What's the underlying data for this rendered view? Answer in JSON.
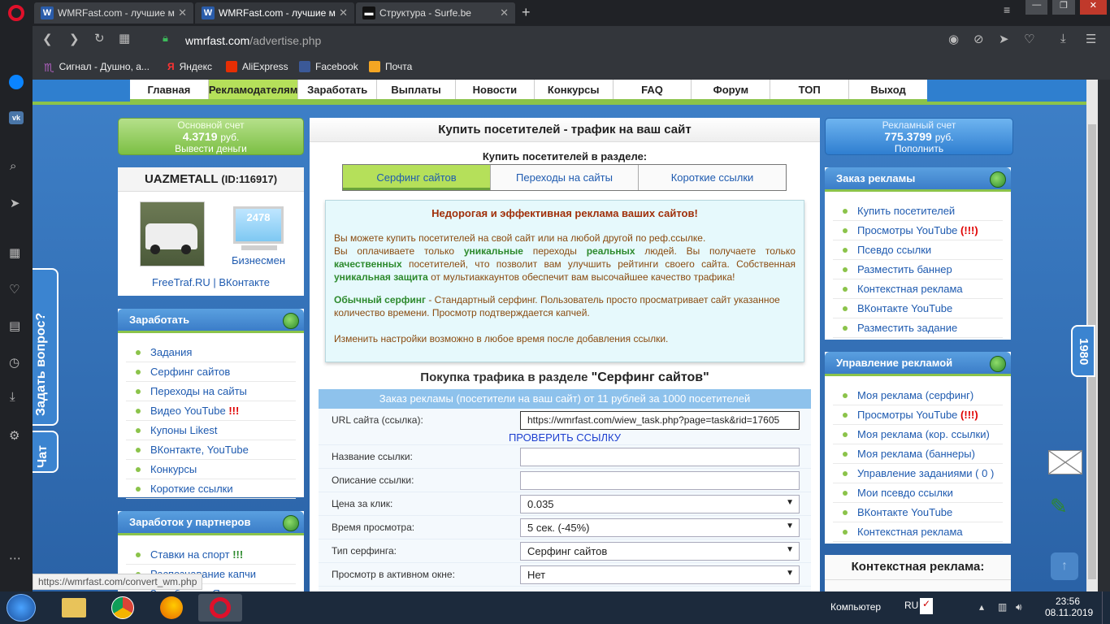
{
  "browser": {
    "tabs": [
      {
        "title": "WMRFast.com - лучшие м"
      },
      {
        "title": "WMRFast.com - лучшие м"
      },
      {
        "title": "Структура - Surfe.be"
      }
    ],
    "address": {
      "host": "wmrfast.com",
      "path": "/advertise.php"
    },
    "bookmarks": [
      "Сигнал - Душно, а...",
      "Яндекс",
      "AliExpress",
      "Facebook",
      "Почта"
    ],
    "status_url": "https://wmrfast.com/convert_wm.php"
  },
  "nav": {
    "items": [
      "Главная",
      "Рекламодателям",
      "Заработать",
      "Выплаты",
      "Новости",
      "Конкурсы",
      "FAQ",
      "Форум",
      "ТОП",
      "Выход"
    ],
    "active": "Рекламодателям"
  },
  "left": {
    "balance": {
      "label": "Основной счет",
      "amount": "4.3719",
      "unit": "руб.",
      "action": "Вывести деньги"
    },
    "user": {
      "name": "UAZMETALL",
      "id": "(ID:116917)",
      "counter": "2478",
      "rank": "Бизнесмен",
      "links": "FreeTraf.RU | ВКонтакте"
    },
    "earn": {
      "title": "Заработать",
      "items": [
        "Задания",
        "Серфинг сайтов",
        "Переходы на сайты",
        "Видео YouTube",
        "Купоны Likest",
        "ВКонтакте, YouTube",
        "Конкурсы",
        "Короткие ссылки"
      ],
      "youtube_mark": "!!!"
    },
    "partners": {
      "title": "Заработок у партнеров",
      "items": [
        "Ставки на спорт",
        "Распознавание капчи",
        "Заработок с Яндексом"
      ],
      "sport_mark": "!!!"
    }
  },
  "center": {
    "title": "Купить посетителей - трафик на ваш сайт",
    "section_label": "Купить посетителей в разделе:",
    "tabs": [
      "Серфинг сайтов",
      "Переходы на сайты",
      "Короткие ссылки"
    ],
    "info": {
      "heading": "Недорогая и эффективная реклама ваших сайтов!",
      "p1a": "Вы можете купить посетителей на свой сайт или на любой другой по реф.ссылке.",
      "p1b": "Вы оплачиваете только",
      "w_unique": "уникальные",
      "p1c": "переходы",
      "w_real": "реальных",
      "p1d": "людей. Вы получаете только",
      "w_quality": "качественных",
      "p1e": "посетителей, что позволит вам улучшить рейтинги своего сайта. Собственная",
      "w_protect": "уникальная защита",
      "p1f": "от мультиаккаунтов обеспечит вам высочайшее качество трафика!",
      "surf_bold": "Обычный серфинг",
      "surf_text": "- Стандартный серфинг. Пользователь просто просматривает сайт указанное количество времени. Просмотр подтверждается капчей.",
      "settings": "Изменить настройки возможно в любое время после добавления ссылки."
    },
    "form_title_a": "Покупка трафика в разделе",
    "form_title_b": "\"Серфинг сайтов\"",
    "form_header": "Заказ рекламы (посетители на ваш сайт) от 11 рублей за 1000 посетителей",
    "url_label": "URL сайта (ссылка):",
    "url_value": "https://wmrfast.com/wiew_task.php?page=task&rid=17605",
    "check_link": "ПРОВЕРИТЬ ССЫЛКУ",
    "fields": [
      {
        "label": "Название ссылки:",
        "value": ""
      },
      {
        "label": "Описание ссылки:",
        "value": ""
      },
      {
        "label": "Цена за клик:",
        "value": "0.035"
      },
      {
        "label": "Время просмотра:",
        "value": "5 сек. (-45%)"
      },
      {
        "label": "Тип серфинга:",
        "value": "Серфинг сайтов"
      },
      {
        "label": "Просмотр в активном окне:",
        "value": "Нет"
      }
    ]
  },
  "right": {
    "balance": {
      "label": "Рекламный счет",
      "amount": "775.3799",
      "unit": "руб.",
      "action": "Пополнить"
    },
    "order": {
      "title": "Заказ рекламы",
      "items": [
        "Купить посетителей",
        "Просмотры YouTube",
        "Псевдо ссылки",
        "Разместить баннер",
        "Контекстная реклама",
        "ВКонтакте YouTube",
        "Разместить задание"
      ],
      "yt_mark": "(!!!)"
    },
    "manage": {
      "title": "Управление рекламой",
      "items": [
        "Моя реклама (серфинг)",
        "Просмотры YouTube",
        "Моя реклама (кор. ссылки)",
        "Моя реклама (баннеры)",
        "Управление заданиями ( 0 )",
        "Мои псевдо ссылки",
        "ВКонтакте YouTube",
        "Контекстная реклама"
      ],
      "yt_mark": "(!!!)"
    },
    "context_title": "Контекстная реклама:"
  },
  "side_widgets": {
    "ask": "Задать вопрос?",
    "chat": "Чат",
    "online": "1980"
  },
  "taskbar": {
    "computer": "Компьютер",
    "lang": "RU",
    "time": "23:56",
    "date": "08.11.2019"
  }
}
